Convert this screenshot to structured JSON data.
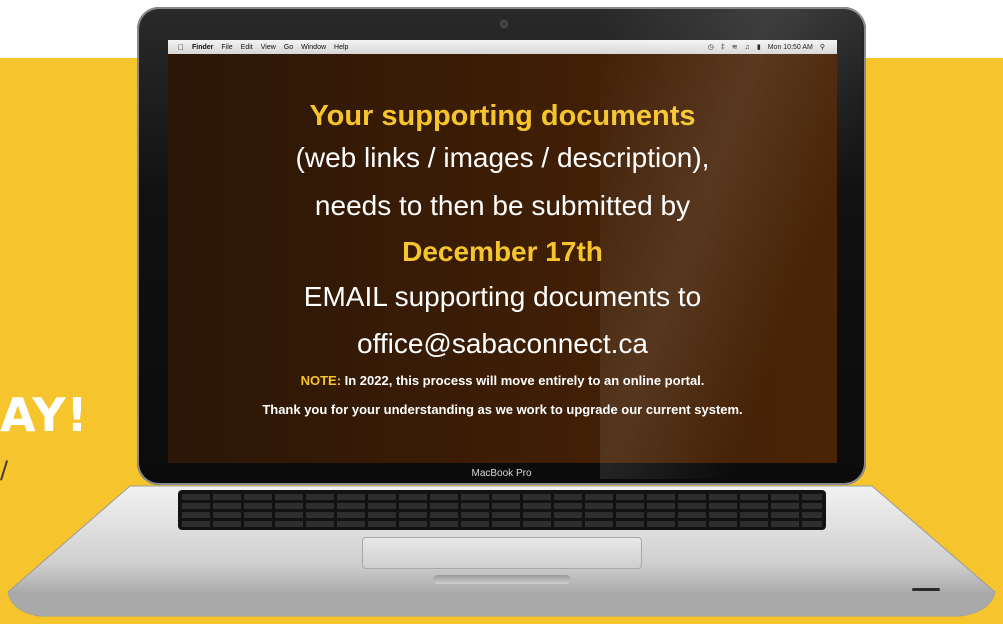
{
  "background": {
    "partial_heading": "AY!",
    "partial_text": "/"
  },
  "menubar": {
    "apple_icon": "apple-icon",
    "app_name": "Finder",
    "items": [
      "File",
      "Edit",
      "View",
      "Go",
      "Window",
      "Help"
    ],
    "status_icons": [
      "time-machine-icon",
      "bluetooth-icon",
      "wifi-icon",
      "volume-icon",
      "battery-icon"
    ],
    "clock": "Mon 10:50 AM",
    "spotlight_icon": "spotlight-icon"
  },
  "screen": {
    "heading": "Your supporting documents",
    "line2": "(web links / images / description),",
    "line3": "needs to then be submitted by",
    "deadline": "December 17th",
    "line5": "EMAIL supporting documents to",
    "email": "office@sabaconnect.ca",
    "note_label": "NOTE:",
    "note_text": " In 2022, this process will move entirely to an online portal.",
    "thanks": "Thank you for your understanding as we work to upgrade our current system."
  },
  "laptop": {
    "model": "MacBook Pro"
  },
  "colors": {
    "accent_yellow": "#f6c52e",
    "screen_brown": "#3e1e05",
    "text_white": "#ffffff"
  }
}
